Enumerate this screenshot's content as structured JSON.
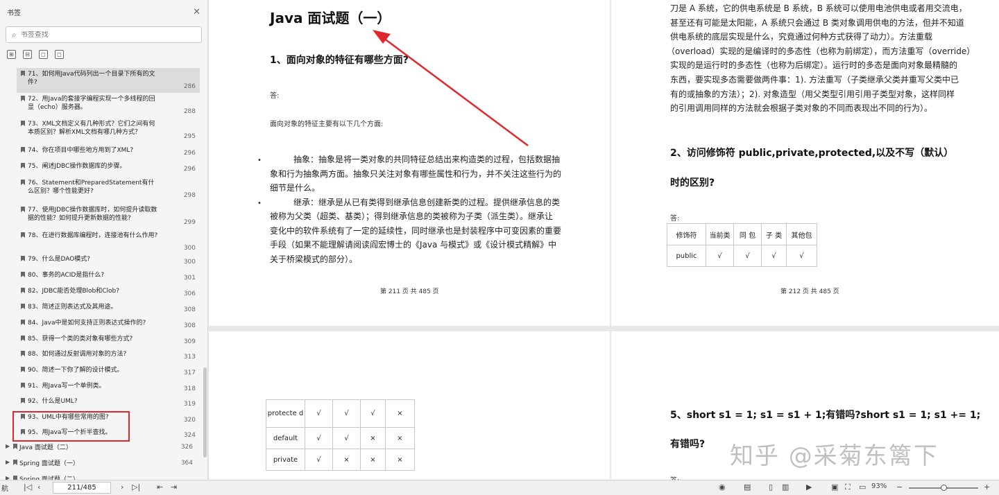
{
  "sidebar": {
    "title": "书签",
    "close": "✕",
    "search_placeholder": "书签查找",
    "tools": [
      "⊞",
      "⊟",
      "◻",
      "◻"
    ],
    "items": [
      {
        "text": "71、如何用Java代码列出一个目录下所有的文件?",
        "page": "286",
        "active": true
      },
      {
        "text": "72、用Java的套接字编程实现一个多线程的回显（echo）服务器。",
        "page": "288"
      },
      {
        "text": "73、XML文档定义有几种形式？它们之间有何本质区别？解析XML文档有哪几种方式？",
        "page": "295"
      },
      {
        "text": "74、你在项目中哪些地方用到了XML?",
        "page": "296"
      },
      {
        "text": "75、阐述JDBC操作数据库的步骤。",
        "page": "296"
      },
      {
        "text": "76、Statement和PreparedStatement有什么区别？哪个性能更好?",
        "page": "298"
      },
      {
        "text": "77、使用JDBC操作数据库时，如何提升读取数据的性能？如何提升更新数据的性能?",
        "page": "299"
      },
      {
        "text": "78、在进行数据库编程时，连接池有什么作用?",
        "page": "300"
      },
      {
        "text": "79、什么是DAO模式?",
        "page": "300"
      },
      {
        "text": "80、事务的ACID是指什么?",
        "page": "301"
      },
      {
        "text": "82、JDBC能否处理Blob和Clob?",
        "page": "306"
      },
      {
        "text": "83、简述正则表达式及其用途。",
        "page": "308"
      },
      {
        "text": "84、Java中是如何支持正则表达式操作的?",
        "page": "308"
      },
      {
        "text": "85、获得一个类的类对象有哪些方式?",
        "page": "309"
      },
      {
        "text": "88、如何通过反射调用对象的方法?",
        "page": "313"
      },
      {
        "text": "90、简述一下你了解的设计模式。",
        "page": "317"
      },
      {
        "text": "91、用Java写一个单例类。",
        "page": "318"
      },
      {
        "text": "92、什么是UML?",
        "page": "319"
      },
      {
        "text": "93、UML中有哪些常用的图?",
        "page": "320"
      },
      {
        "text": "95、用Java写一个折半查找。",
        "page": "324"
      }
    ],
    "groups": [
      {
        "text": "Java 面试题（二）",
        "page": "326"
      },
      {
        "text": "Spring 面试题（一）",
        "page": "364"
      },
      {
        "text": "Spring 面试题（二）",
        "page": ""
      }
    ]
  },
  "doc": {
    "p211": {
      "title": "Java 面试题（一）",
      "q1": "1、面向对象的特征有哪些方面?",
      "answer_label": "答:",
      "intro": "面向对象的特征主要有以下几个方面:",
      "bullet": "•",
      "b1_lines": [
        "抽象：抽象是将一类对象的共同特征总结出来构造类的过程，包括数据抽",
        "象和行为抽象两方面。抽象只关注对象有哪些属性和行为，并不关注这些行为的",
        "细节是什么。"
      ],
      "b2_lines": [
        "继承：继承是从已有类得到继承信息创建新类的过程。提供继承信息的类",
        "被称为父类（超类、基类）；得到继承信息的类被称为子类（派生类）。继承让",
        "变化中的软件系统有了一定的延续性，同时继承也是封装程序中可变因素的重要",
        "手段（如果不能理解请阅读阎宏博士的《Java 与模式》或《设计模式精解》中",
        "关于桥梁模式的部分）。"
      ],
      "footer": "第 211 页 共 485 页"
    },
    "p212": {
      "lines": [
        "刀是 A 系统，它的供电系统是 B 系统，B 系统可以使用电池供电或者用交流电，",
        "甚至还有可能是太阳能，A 系统只会通过 B 类对象调用供电的方法，但并不知道",
        "供电系统的底层实现是什么，究竟通过何种方式获得了动力）。方法重载",
        "（overload）实现的是编译时的多态性（也称为前绑定），而方法重写（override）",
        "实现的是运行时的多态性（也称为后绑定）。运行时的多态是面向对象最精髓的",
        "东西，要实现多态需要做两件事：1). 方法重写（子类继承父类并重写父类中已",
        "有的或抽象的方法）；2). 对象造型（用父类型引用引用子类型对象，这样同样",
        "的引用调用同样的方法就会根据子类对象的不同而表现出不同的行为）。"
      ],
      "q2_line1": "2、访问修饰符 public,private,protected,以及不写（默认）",
      "q2_line2": "时的区别?",
      "answer_label": "答:",
      "table_header": [
        "修饰符",
        "当前类",
        "同 包",
        "子 类",
        "其他包"
      ],
      "table_row": [
        "public",
        "√",
        "√",
        "√",
        "√"
      ],
      "footer": "第 212 页 共 485 页"
    },
    "p213": {
      "rows": [
        [
          "protecte d",
          "√",
          "√",
          "√",
          "×"
        ],
        [
          "default",
          "√",
          "√",
          "×",
          "×"
        ],
        [
          "private",
          "√",
          "×",
          "×",
          "×"
        ]
      ]
    },
    "p214": {
      "q5_line1": "5、short s1 = 1; s1 = s1 + 1;有错吗?short s1 = 1; s1 += 1;",
      "q5_line2": "有错吗?",
      "answer_label": "答:"
    },
    "watermark": "知乎 @采菊东篱下"
  },
  "status": {
    "nav_label": "航",
    "page_value": "211/485",
    "zoom": "93%",
    "zoom_fraction": 0.5
  },
  "colors": {
    "annotation_red": "#e0282a"
  }
}
